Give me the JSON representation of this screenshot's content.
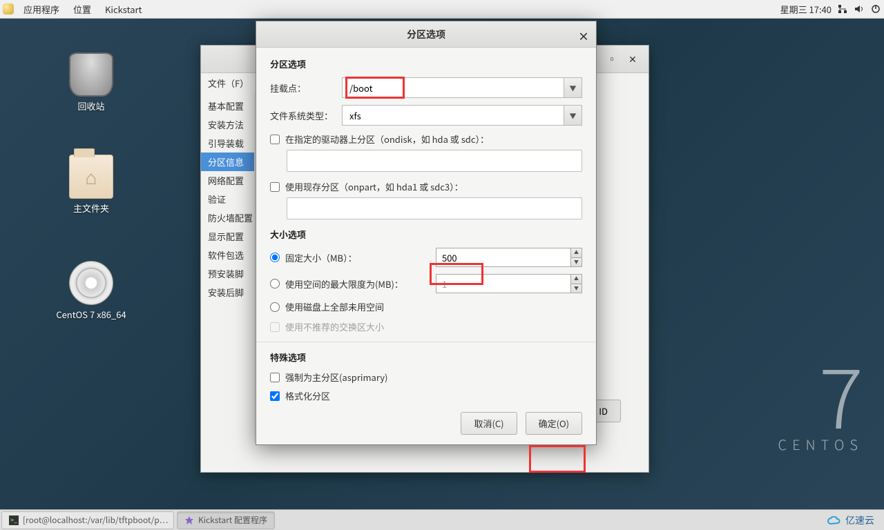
{
  "top_panel": {
    "apps": "应用程序",
    "places": "位置",
    "app_menu": "Kickstart",
    "clock": "星期三 17:40"
  },
  "desktop": {
    "trash": "回收站",
    "home": "主文件夹",
    "disc": "CentOS 7 x86_64"
  },
  "branding": {
    "seven": "7",
    "name": "CENTOS"
  },
  "bg_window": {
    "menu_file": "文件（F）",
    "sidebar": [
      "基本配置",
      "安装方法",
      "引导装载",
      "分区信息",
      "网络配置",
      "验证",
      "防火墙配置",
      "显示配置",
      "软件包选",
      "预安装脚",
      "安装后脚"
    ],
    "selected_index": 3,
    "foot_btn": "ID"
  },
  "dialog": {
    "title": "分区选项",
    "section_partition": "分区选项",
    "mount_label": "挂载点：",
    "mount_value": "/boot",
    "fs_label": "文件系统类型：",
    "fs_value": "xfs",
    "ondisk_label": "在指定的驱动器上分区（ondisk，如 hda 或 sdc）：",
    "onpart_label": "使用现存分区（onpart，如 hda1 或 sdc3）：",
    "section_size": "大小选项",
    "fixed_label": "固定大小（MB）：",
    "fixed_value": "500",
    "max_label": "使用空间的最大限度为(MB)：",
    "max_value": "1",
    "fill_label": "使用磁盘上全部未用空间",
    "swap_label": "使用不推荐的交换区大小",
    "section_special": "特殊选项",
    "asprimary_label": "强制为主分区(asprimary)",
    "format_label": "格式化分区",
    "cancel": "取消(C)",
    "ok": "确定(O)"
  },
  "taskbar": {
    "terminal": "[root@localhost:/var/lib/tftpboot/p…",
    "kickstart": "Kickstart 配置程序",
    "corner": "亿速云"
  }
}
